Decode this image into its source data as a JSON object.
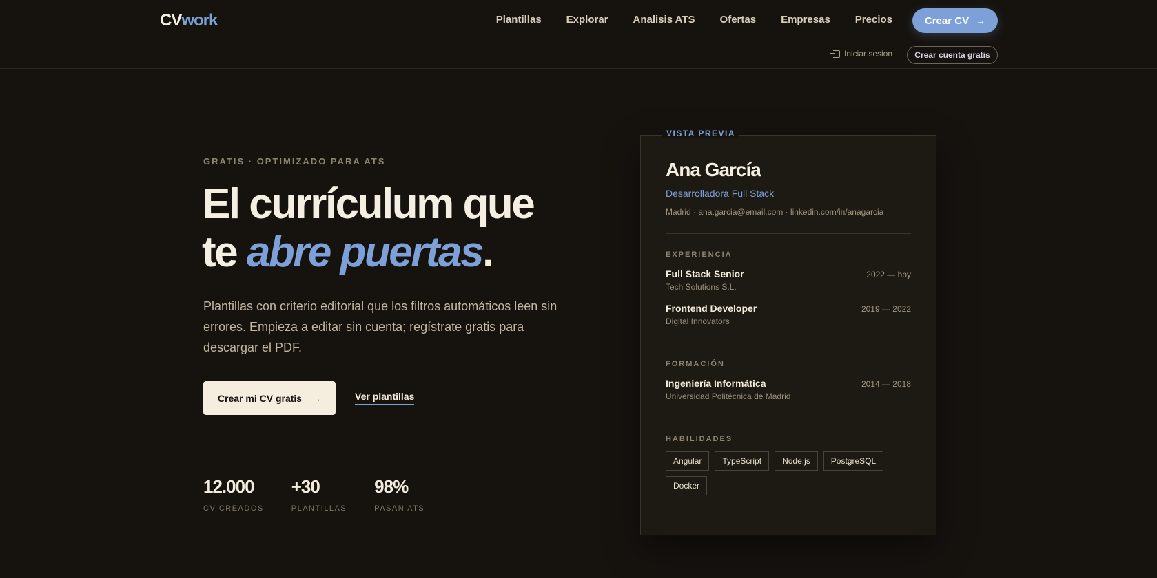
{
  "header": {
    "logo_cv": "CV",
    "logo_work": "work",
    "nav": [
      "Plantillas",
      "Explorar",
      "Analisis ATS",
      "Ofertas",
      "Empresas",
      "Precios"
    ],
    "cta_label": "Crear CV",
    "cta_arrow": "→",
    "login_label": "Iniciar sesion",
    "signup_label": "Crear cuenta gratis"
  },
  "hero": {
    "eyebrow": "GRATIS · OPTIMIZADO PARA ATS",
    "headline_line1": "El currículum que",
    "headline_te": "te ",
    "headline_accent": "abre puertas",
    "headline_dot": ".",
    "lead": "Plantillas con criterio editorial que los filtros automáticos leen sin errores. Empieza a editar sin cuenta; regístrate gratis para descargar el PDF.",
    "primary_label": "Crear mi CV gratis",
    "primary_arrow": "→",
    "secondary_label": "Ver plantillas"
  },
  "stats": [
    {
      "value": "12.000",
      "label": "CV CREADOS"
    },
    {
      "value": "+30",
      "label": "PLANTILLAS"
    },
    {
      "value": "98%",
      "label": "PASAN ATS"
    }
  ],
  "preview": {
    "tag": "VISTA PREVIA",
    "name": "Ana García",
    "role": "Desarrolladora Full Stack",
    "contact": "Madrid · ana.garcia@email.com · linkedin.com/in/anagarcia",
    "experience_title": "EXPERIENCIA",
    "experience": [
      {
        "title": "Full Stack Senior",
        "company": "Tech Solutions S.L.",
        "years": "2022 — hoy"
      },
      {
        "title": "Frontend Developer",
        "company": "Digital Innovators",
        "years": "2019 — 2022"
      }
    ],
    "education_title": "FORMACIÓN",
    "education": [
      {
        "title": "Ingeniería Informática",
        "school": "Universidad Politécnica de Madrid",
        "years": "2014 — 2018"
      }
    ],
    "skills_title": "HABILIDADES",
    "skills": [
      "Angular",
      "TypeScript",
      "Node.js",
      "PostgreSQL",
      "Docker"
    ]
  },
  "colors": {
    "background": "#16130f",
    "accent": "#7da0d8",
    "text": "#f3ebdc"
  }
}
